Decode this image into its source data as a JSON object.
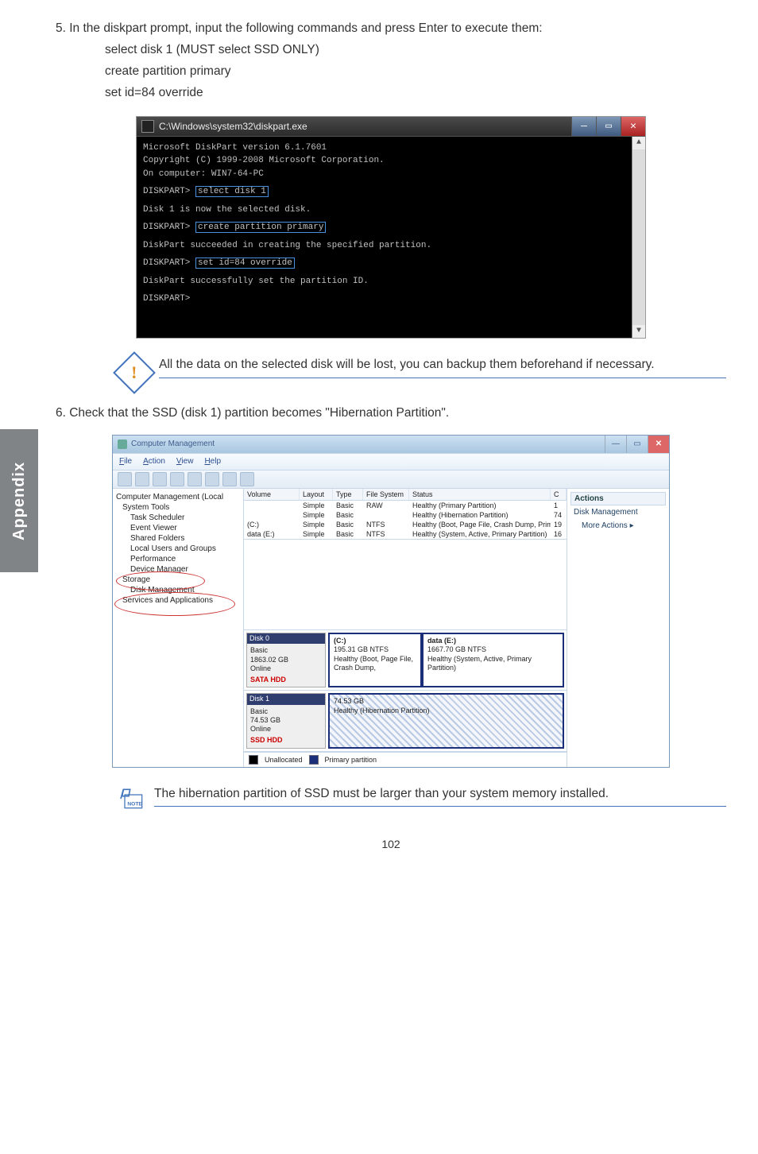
{
  "side_tab": "Appendix",
  "step5": {
    "intro": "5. In the diskpart prompt, input the following commands and press Enter to execute them:",
    "line1": "select disk 1 (MUST select SSD ONLY)",
    "line2": "create partition primary",
    "line3": "set id=84 override"
  },
  "cmd": {
    "title": "C:\\Windows\\system32\\diskpart.exe",
    "l1": "Microsoft DiskPart version 6.1.7601",
    "l2": "Copyright (C) 1999-2008 Microsoft Corporation.",
    "l3": "On computer: WIN7-64-PC",
    "p1_prefix": "DISKPART> ",
    "p1_cmd": "select disk 1",
    "r1": "Disk 1 is now the selected disk.",
    "p2_prefix": "DISKPART> ",
    "p2_cmd": "create partition primary",
    "r2": "DiskPart succeeded in creating the specified partition.",
    "p3_prefix": "DISKPART> ",
    "p3_cmd": "set id=84 override",
    "r3": "DiskPart successfully set the partition ID.",
    "p4": "DISKPART>"
  },
  "caution": "All the data on the selected disk will be lost, you can backup them beforehand if necessary.",
  "step6": "6. Check that the SSD (disk 1) partition becomes \"Hibernation Partition\".",
  "mgmt": {
    "title": "Computer Management",
    "menu": {
      "file": "File",
      "action": "Action",
      "view": "View",
      "help": "Help"
    },
    "tree": {
      "root": "Computer Management (Local",
      "sys": "System Tools",
      "task": "Task Scheduler",
      "event": "Event Viewer",
      "shared": "Shared Folders",
      "users": "Local Users and Groups",
      "perf": "Performance",
      "devmgr": "Device Manager",
      "storage": "Storage",
      "diskmgmt": "Disk Management",
      "svcs": "Services and Applications"
    },
    "cols": {
      "vol": "Volume",
      "layout": "Layout",
      "type": "Type",
      "fs": "File System",
      "status": "Status",
      "c": "C"
    },
    "rows": [
      {
        "vol": "",
        "layout": "Simple",
        "type": "Basic",
        "fs": "RAW",
        "status": "Healthy (Primary Partition)",
        "c": "1"
      },
      {
        "vol": "",
        "layout": "Simple",
        "type": "Basic",
        "fs": "",
        "status": "Healthy (Hibernation Partition)",
        "c": "74"
      },
      {
        "vol": "(C:)",
        "layout": "Simple",
        "type": "Basic",
        "fs": "NTFS",
        "status": "Healthy (Boot, Page File, Crash Dump, Primary Partition)",
        "c": "19"
      },
      {
        "vol": "data (E:)",
        "layout": "Simple",
        "type": "Basic",
        "fs": "NTFS",
        "status": "Healthy (System, Active, Primary Partition)",
        "c": "16"
      }
    ],
    "disk0": {
      "name": "Disk 0",
      "type": "Basic",
      "size": "1863.02 GB",
      "state": "Online",
      "label": "SATA HDD",
      "p1": {
        "title": "(C:)",
        "size": "195.31 GB NTFS",
        "stat": "Healthy (Boot, Page File, Crash Dump,"
      },
      "p2": {
        "title": "data (E:)",
        "size": "1667.70 GB NTFS",
        "stat": "Healthy (System, Active, Primary Partition)"
      }
    },
    "disk1": {
      "name": "Disk 1",
      "type": "Basic",
      "size": "74.53 GB",
      "state": "Online",
      "label": "SSD HDD",
      "p1": {
        "size": "74.53 GB",
        "stat": "Healthy (Hibernation Partition)"
      }
    },
    "legend": {
      "unalloc": "Unallocated",
      "primary": "Primary partition"
    },
    "actions": {
      "header": "Actions",
      "a1": "Disk Management",
      "a2": "More Actions"
    }
  },
  "note": "The hibernation partition of SSD must be larger than your system memory installed.",
  "page_number": "102"
}
